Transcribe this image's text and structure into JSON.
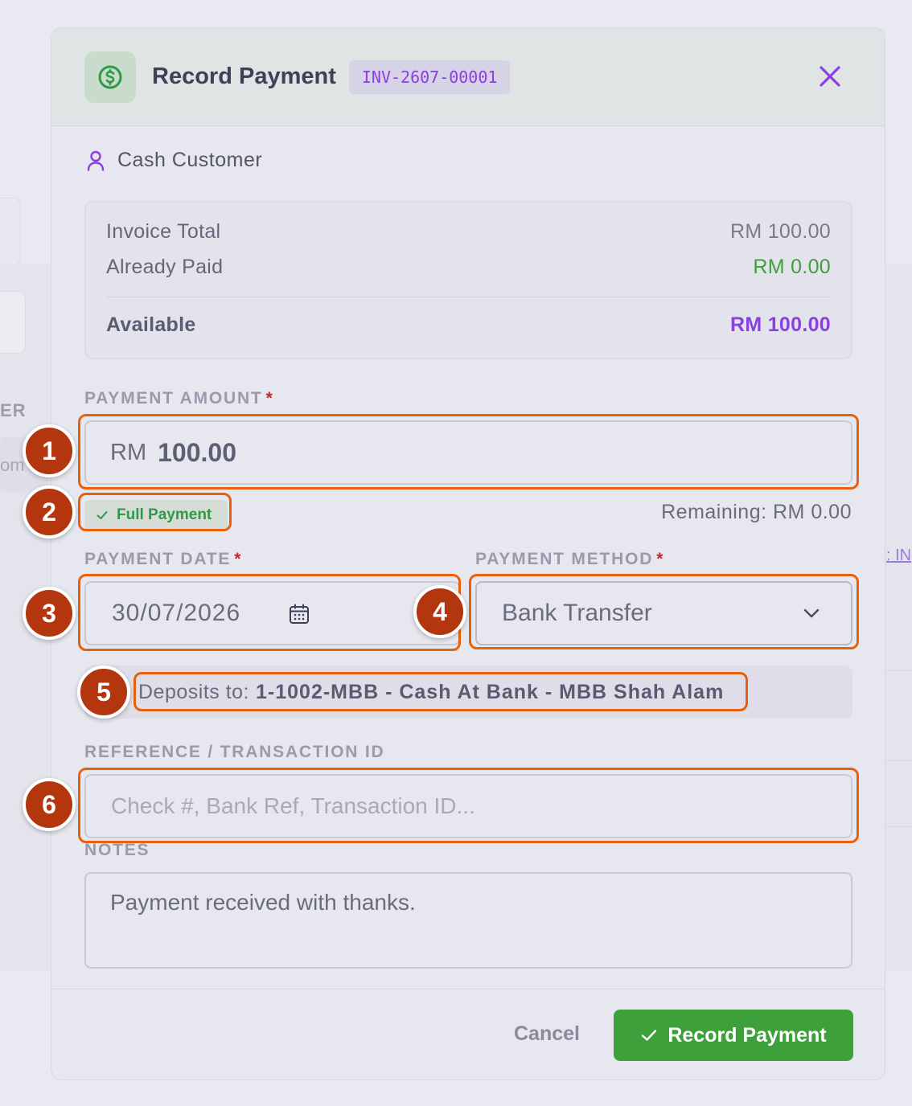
{
  "modal": {
    "title": "Record Payment",
    "invoice_id": "INV-2607-00001",
    "close_icon": "close-icon"
  },
  "customer": {
    "name": "Cash Customer",
    "icon": "user-icon"
  },
  "summary": {
    "invoice_total_label": "Invoice Total",
    "invoice_total_value": "RM 100.00",
    "already_paid_label": "Already Paid",
    "already_paid_value": "RM 0.00",
    "available_label": "Available",
    "available_value": "RM 100.00"
  },
  "payment_amount": {
    "label": "PAYMENT AMOUNT",
    "required": "*",
    "currency": "RM",
    "value": "100.00",
    "status_badge": "Full Payment",
    "remaining": "Remaining: RM 0.00"
  },
  "payment_date": {
    "label": "PAYMENT DATE",
    "required": "*",
    "value": "30/07/2026"
  },
  "payment_method": {
    "label": "PAYMENT METHOD",
    "required": "*",
    "value": "Bank Transfer"
  },
  "deposit": {
    "prefix": "Deposits to:",
    "account": "1-1002-MBB - Cash At Bank - MBB Shah Alam"
  },
  "reference": {
    "label": "REFERENCE / TRANSACTION ID",
    "placeholder": "Check #, Bank Ref, Transaction ID..."
  },
  "notes": {
    "label": "NOTES",
    "value": "Payment received with thanks."
  },
  "footer": {
    "cancel_label": "Cancel",
    "record_label": "Record Payment"
  },
  "background": {
    "fragment_er": "ER",
    "fragment_om": "om",
    "fragment_link": ": IN"
  },
  "markers": [
    "1",
    "2",
    "3",
    "4",
    "5",
    "6"
  ],
  "colors": {
    "accent_purple": "#8a3fe0",
    "success_green": "#3ea03a",
    "annotation_orange": "#e8600d",
    "marker_fill": "#b3360e"
  }
}
